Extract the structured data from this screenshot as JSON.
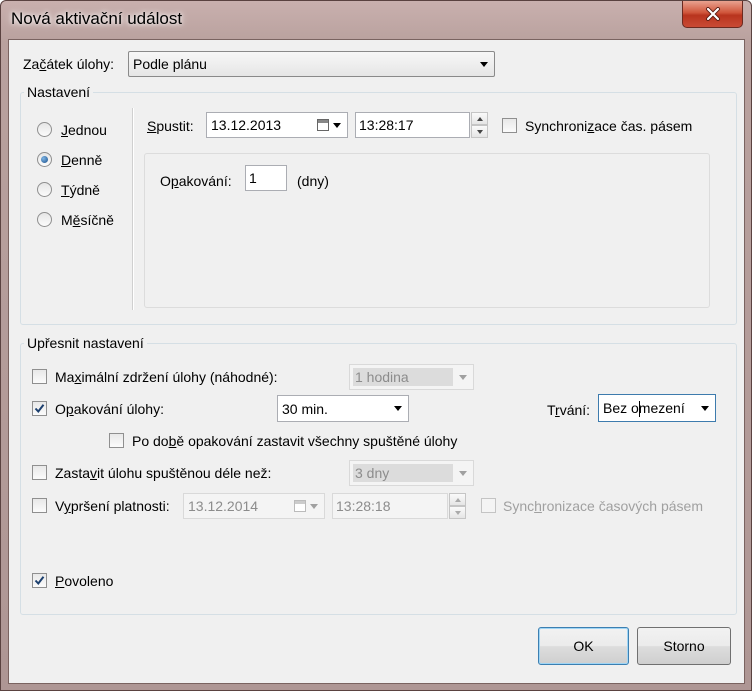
{
  "window": {
    "title": "Nová aktivační událost",
    "close_icon": "close-icon"
  },
  "start": {
    "label_pre": "Za",
    "label_ul": "č",
    "label_post": "átek úlohy:",
    "value": "Podle plánu"
  },
  "settings": {
    "group_title": "Nastavení",
    "radios": [
      {
        "pre": "",
        "ul": "J",
        "post": "ednou",
        "selected": false
      },
      {
        "pre": "",
        "ul": "D",
        "post": "enně",
        "selected": true
      },
      {
        "pre": "",
        "ul": "T",
        "post": "ýdně",
        "selected": false
      },
      {
        "pre": "M",
        "ul": "ě",
        "post": "síčně",
        "selected": false
      }
    ],
    "spustit_label_ul": "S",
    "spustit_label_post": "pustit:",
    "date_value": "13.12.2013",
    "time_value": "13:28:17",
    "sync_pre": "Synchroni",
    "sync_ul": "z",
    "sync_post": "ace čas. pásem",
    "sync_checked": false,
    "repeat_pre": "O",
    "repeat_ul": "p",
    "repeat_post": "akování:",
    "repeat_value": "1",
    "repeat_unit": "(dny)"
  },
  "advanced": {
    "group_title": "Upřesnit nastavení",
    "max_delay": {
      "pre": "Ma",
      "ul": "x",
      "post": "imální zdržení úlohy (náhodné):",
      "checked": false,
      "value": "1 hodina"
    },
    "repeat_task": {
      "pre": "O",
      "ul": "p",
      "post": "akování úlohy:",
      "checked": true,
      "value": "30 min."
    },
    "duration": {
      "pre": "T",
      "ul": "r",
      "post": "vání:",
      "value": "Bez omezení"
    },
    "stop_all": {
      "pre": "Po do",
      "ul": "b",
      "post": "ě opakování zastavit všechny spuštěné úlohy",
      "checked": false
    },
    "stop_longer": {
      "pre": "Zasta",
      "ul": "v",
      "post": "it úlohu spuštěnou déle než:",
      "checked": false,
      "value": "3 dny"
    },
    "expire": {
      "pre": "V",
      "ul": "y",
      "post": "pršení platnosti:",
      "checked": false,
      "date": "13.12.2014",
      "time": "13:28:18"
    },
    "expire_sync": {
      "pre": "Sync",
      "ul": "h",
      "post": "ronizace časových pásem",
      "checked": false
    },
    "enabled": {
      "pre": "",
      "ul": "P",
      "post": "ovoleno",
      "checked": true
    }
  },
  "buttons": {
    "ok": "OK",
    "cancel": "Storno"
  }
}
